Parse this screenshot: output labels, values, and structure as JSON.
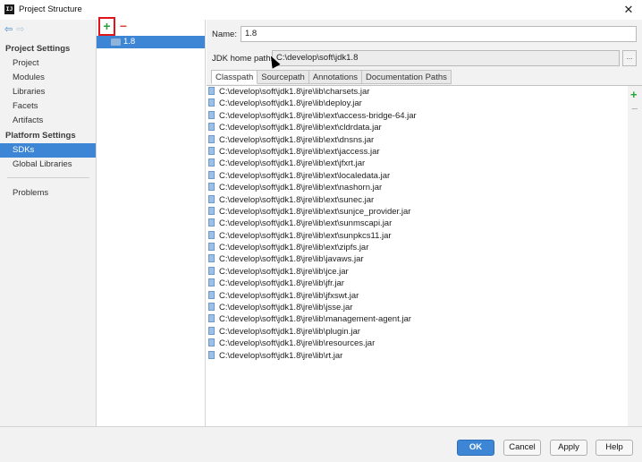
{
  "window": {
    "icon_text": "IJ",
    "title": "Project Structure",
    "close_label": "✕"
  },
  "nav": {
    "back_icon": "arrow-left-icon",
    "forward_icon": "arrow-right-icon",
    "project_settings_header": "Project Settings",
    "project_settings_items": [
      "Project",
      "Modules",
      "Libraries",
      "Facets",
      "Artifacts"
    ],
    "platform_settings_header": "Platform Settings",
    "platform_settings_items": [
      "SDKs",
      "Global Libraries"
    ],
    "extra_items": [
      "Problems"
    ],
    "selected": "SDKs"
  },
  "sdk_list": {
    "add_label": "+",
    "remove_label": "−",
    "items": [
      "1.8"
    ]
  },
  "detail": {
    "name_label": "Name:",
    "name_value": "1.8",
    "jdk_home_label": "JDK home path:",
    "jdk_home_value": "C:\\develop\\soft\\jdk1.8",
    "browse_label": "...",
    "tabs": [
      "Classpath",
      "Sourcepath",
      "Annotations",
      "Documentation Paths"
    ],
    "active_tab": "Classpath",
    "classpath": [
      "C:\\develop\\soft\\jdk1.8\\jre\\lib\\charsets.jar",
      "C:\\develop\\soft\\jdk1.8\\jre\\lib\\deploy.jar",
      "C:\\develop\\soft\\jdk1.8\\jre\\lib\\ext\\access-bridge-64.jar",
      "C:\\develop\\soft\\jdk1.8\\jre\\lib\\ext\\cldrdata.jar",
      "C:\\develop\\soft\\jdk1.8\\jre\\lib\\ext\\dnsns.jar",
      "C:\\develop\\soft\\jdk1.8\\jre\\lib\\ext\\jaccess.jar",
      "C:\\develop\\soft\\jdk1.8\\jre\\lib\\ext\\jfxrt.jar",
      "C:\\develop\\soft\\jdk1.8\\jre\\lib\\ext\\localedata.jar",
      "C:\\develop\\soft\\jdk1.8\\jre\\lib\\ext\\nashorn.jar",
      "C:\\develop\\soft\\jdk1.8\\jre\\lib\\ext\\sunec.jar",
      "C:\\develop\\soft\\jdk1.8\\jre\\lib\\ext\\sunjce_provider.jar",
      "C:\\develop\\soft\\jdk1.8\\jre\\lib\\ext\\sunmscapi.jar",
      "C:\\develop\\soft\\jdk1.8\\jre\\lib\\ext\\sunpkcs11.jar",
      "C:\\develop\\soft\\jdk1.8\\jre\\lib\\ext\\zipfs.jar",
      "C:\\develop\\soft\\jdk1.8\\jre\\lib\\javaws.jar",
      "C:\\develop\\soft\\jdk1.8\\jre\\lib\\jce.jar",
      "C:\\develop\\soft\\jdk1.8\\jre\\lib\\jfr.jar",
      "C:\\develop\\soft\\jdk1.8\\jre\\lib\\jfxswt.jar",
      "C:\\develop\\soft\\jdk1.8\\jre\\lib\\jsse.jar",
      "C:\\develop\\soft\\jdk1.8\\jre\\lib\\management-agent.jar",
      "C:\\develop\\soft\\jdk1.8\\jre\\lib\\plugin.jar",
      "C:\\develop\\soft\\jdk1.8\\jre\\lib\\resources.jar",
      "C:\\develop\\soft\\jdk1.8\\jre\\lib\\rt.jar"
    ],
    "side_add": "+",
    "side_remove": "−"
  },
  "buttons": {
    "ok": "OK",
    "cancel": "Cancel",
    "apply": "Apply",
    "help": "Help"
  },
  "colors": {
    "selection": "#3d86d6",
    "add_green": "#2aa33b",
    "remove_red": "#d9433a",
    "highlight_box": "#e2141b"
  }
}
